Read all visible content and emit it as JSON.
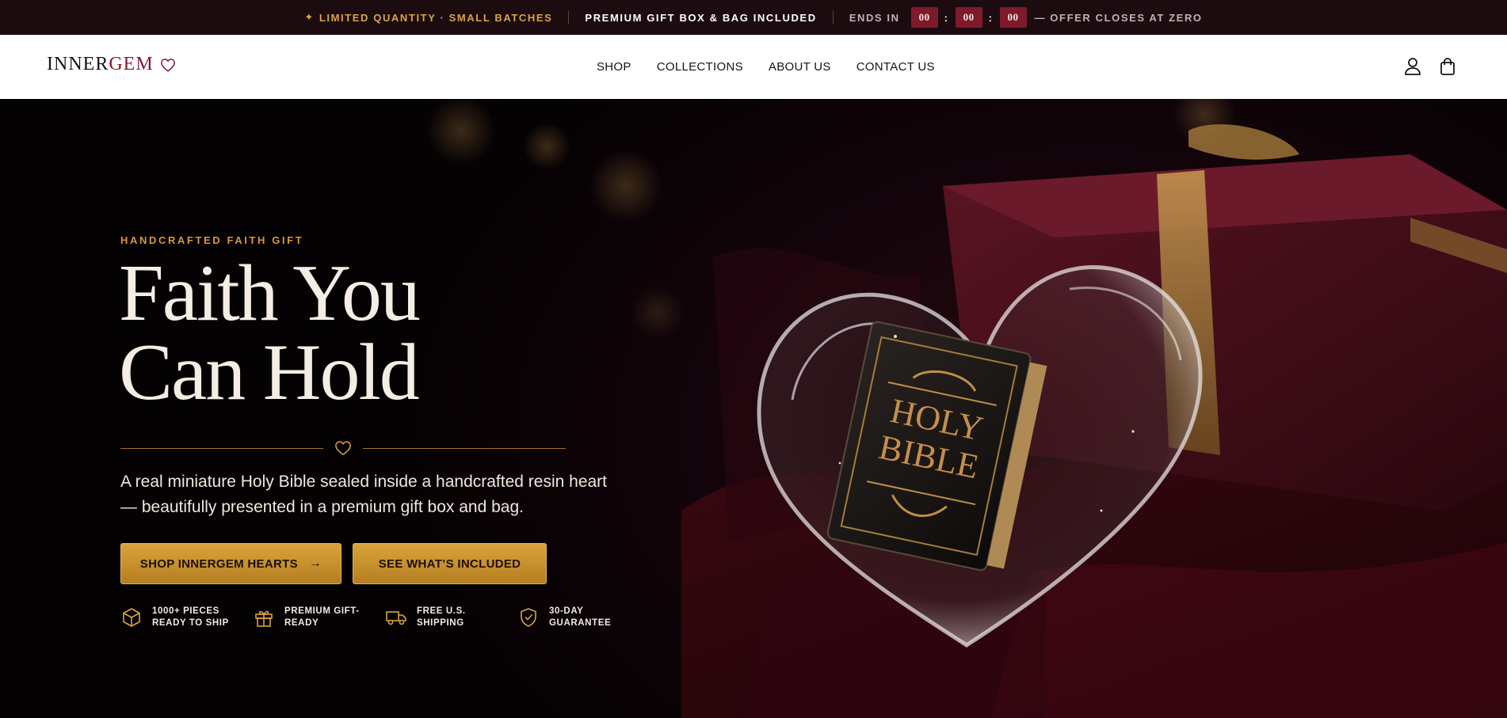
{
  "announcement": {
    "limited": "Limited Quantity · Small Batches",
    "gift": "Premium Gift Box & Bag Included",
    "ends_in": "Ends In",
    "timer": [
      "00",
      "00",
      "00"
    ],
    "closes": "— Offer closes at zero"
  },
  "header": {
    "logo_part1": "INNER",
    "logo_part2": "GEM",
    "nav": [
      "SHOP",
      "COLLECTIONS",
      "ABOUT US",
      "CONTACT US"
    ]
  },
  "hero": {
    "eyebrow": "Handcrafted Faith Gift",
    "headline_line1": "Faith You",
    "headline_line2": "Can Hold",
    "subcopy": "A real miniature Holy Bible sealed inside a handcrafted resin heart — beautifully presented in a premium gift box and bag.",
    "cta_primary": "Shop InnerGem Hearts",
    "cta_secondary": "See What’s Included",
    "bible_line1": "HOLY",
    "bible_line2": "BIBLE"
  },
  "features": [
    {
      "icon": "box-icon",
      "label": "1000+ Pieces Ready To Ship"
    },
    {
      "icon": "gift-icon",
      "label": "Premium Gift-Ready"
    },
    {
      "icon": "truck-icon",
      "label": "Free U.S. Shipping"
    },
    {
      "icon": "shield-check-icon",
      "label": "30-Day Guarantee"
    }
  ],
  "colors": {
    "gold": "#d9a441",
    "burgundy": "#7e1a2a",
    "dark": "#1c0c10"
  }
}
